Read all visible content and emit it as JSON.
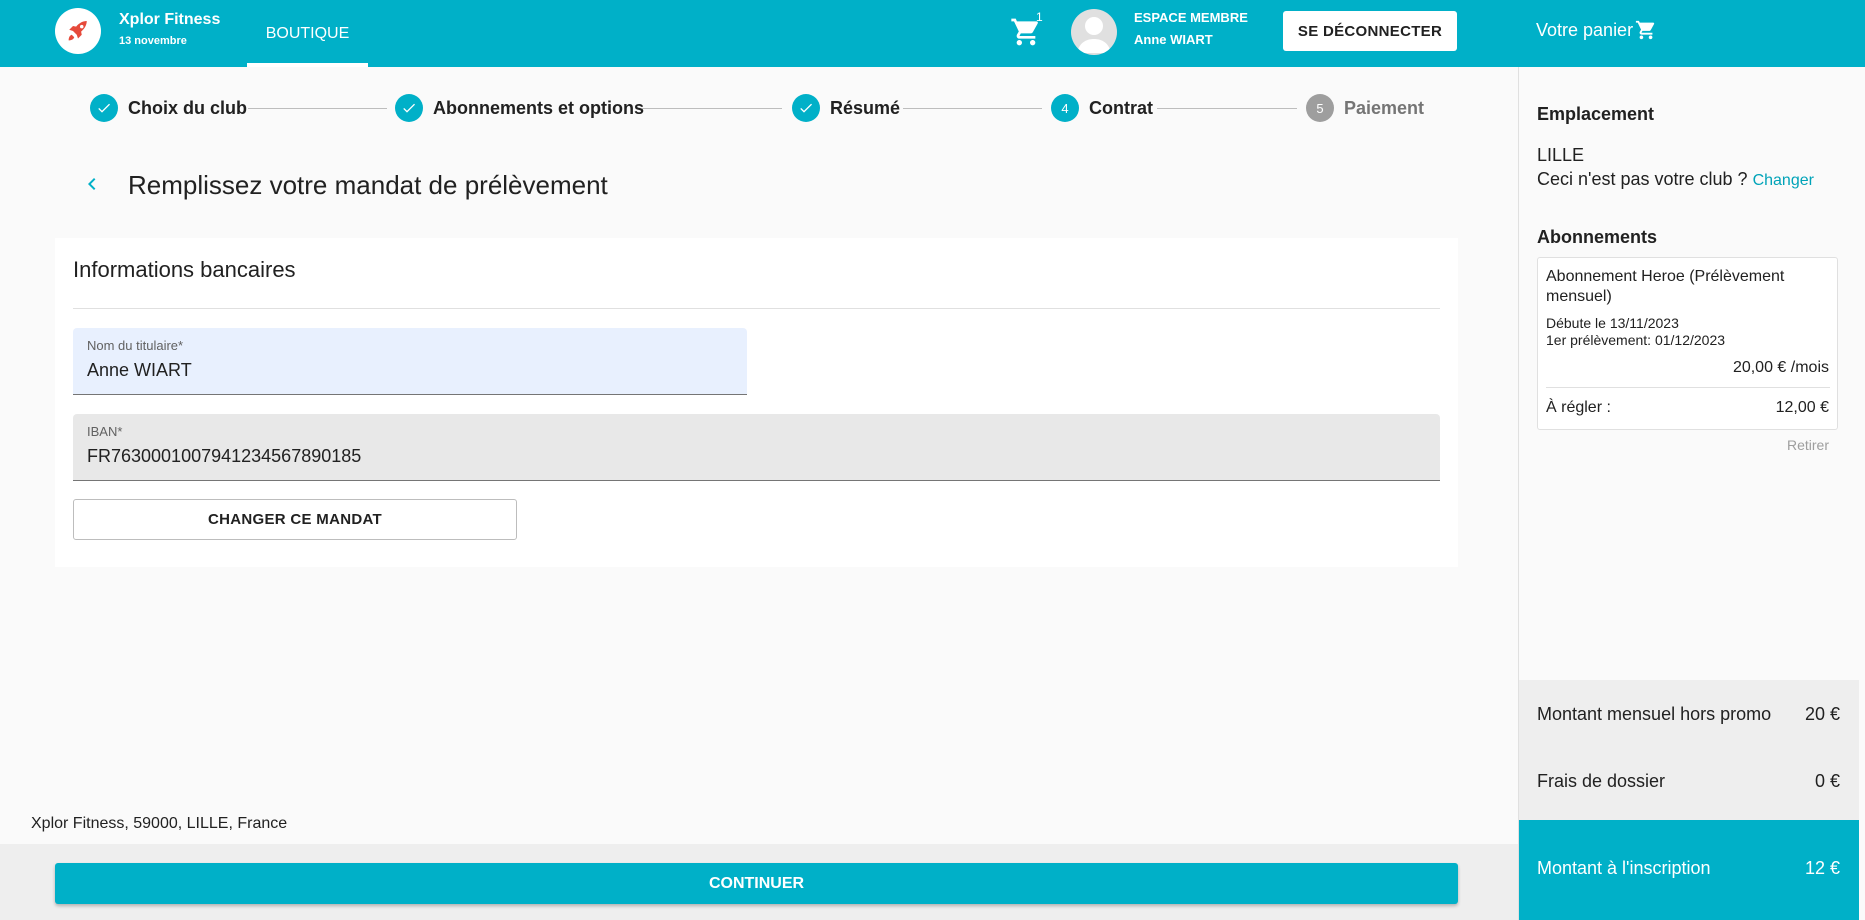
{
  "header": {
    "brand_name": "Xplor Fitness",
    "brand_date": "13 novembre",
    "nav_tab": "BOUTIQUE",
    "cart_count": "1",
    "member_label": "ESPACE MEMBRE",
    "member_name": "Anne WIART",
    "logout_label": "SE DÉCONNECTER",
    "your_cart_label": "Votre panier"
  },
  "stepper": {
    "steps": [
      {
        "label": "Choix du club",
        "state": "done"
      },
      {
        "label": "Abonnements et options",
        "state": "done"
      },
      {
        "label": "Résumé",
        "state": "done"
      },
      {
        "label": "Contrat",
        "number": "4",
        "state": "active"
      },
      {
        "label": "Paiement",
        "number": "5",
        "state": "inactive"
      }
    ]
  },
  "page": {
    "title": "Remplissez votre mandat de prélèvement"
  },
  "bank_card": {
    "title": "Informations bancaires",
    "holder_label": "Nom du titulaire*",
    "holder_value": "Anne WIART",
    "iban_label": "IBAN*",
    "iban_value": "FR7630001007941234567890185",
    "change_button": "CHANGER CE MANDAT"
  },
  "footer": {
    "address": "Xplor Fitness, 59000, LILLE, France",
    "continue_button": "CONTINUER"
  },
  "sidebar": {
    "location_heading": "Emplacement",
    "city": "LILLE",
    "not_your_club": "Ceci n'est pas votre club ?",
    "change_link": "Changer",
    "subscriptions_heading": "Abonnements",
    "subscription": {
      "name": "Abonnement Heroe (Prélèvement mensuel)",
      "start": "Débute le 13/11/2023",
      "first_debit": "1er prélèvement: 01/12/2023",
      "price": "20,00 € /mois",
      "due_label": "À régler :",
      "due_value": "12,00 €",
      "remove_label": "Retirer"
    },
    "summary": {
      "monthly_label": "Montant mensuel hors promo",
      "monthly_value": "20 €",
      "fees_label": "Frais de dossier",
      "fees_value": "0 €",
      "total_label": "Montant à l'inscription",
      "total_value": "12 €"
    }
  },
  "colors": {
    "accent": "#00b0c8",
    "inactive_step": "#9e9e9e"
  }
}
